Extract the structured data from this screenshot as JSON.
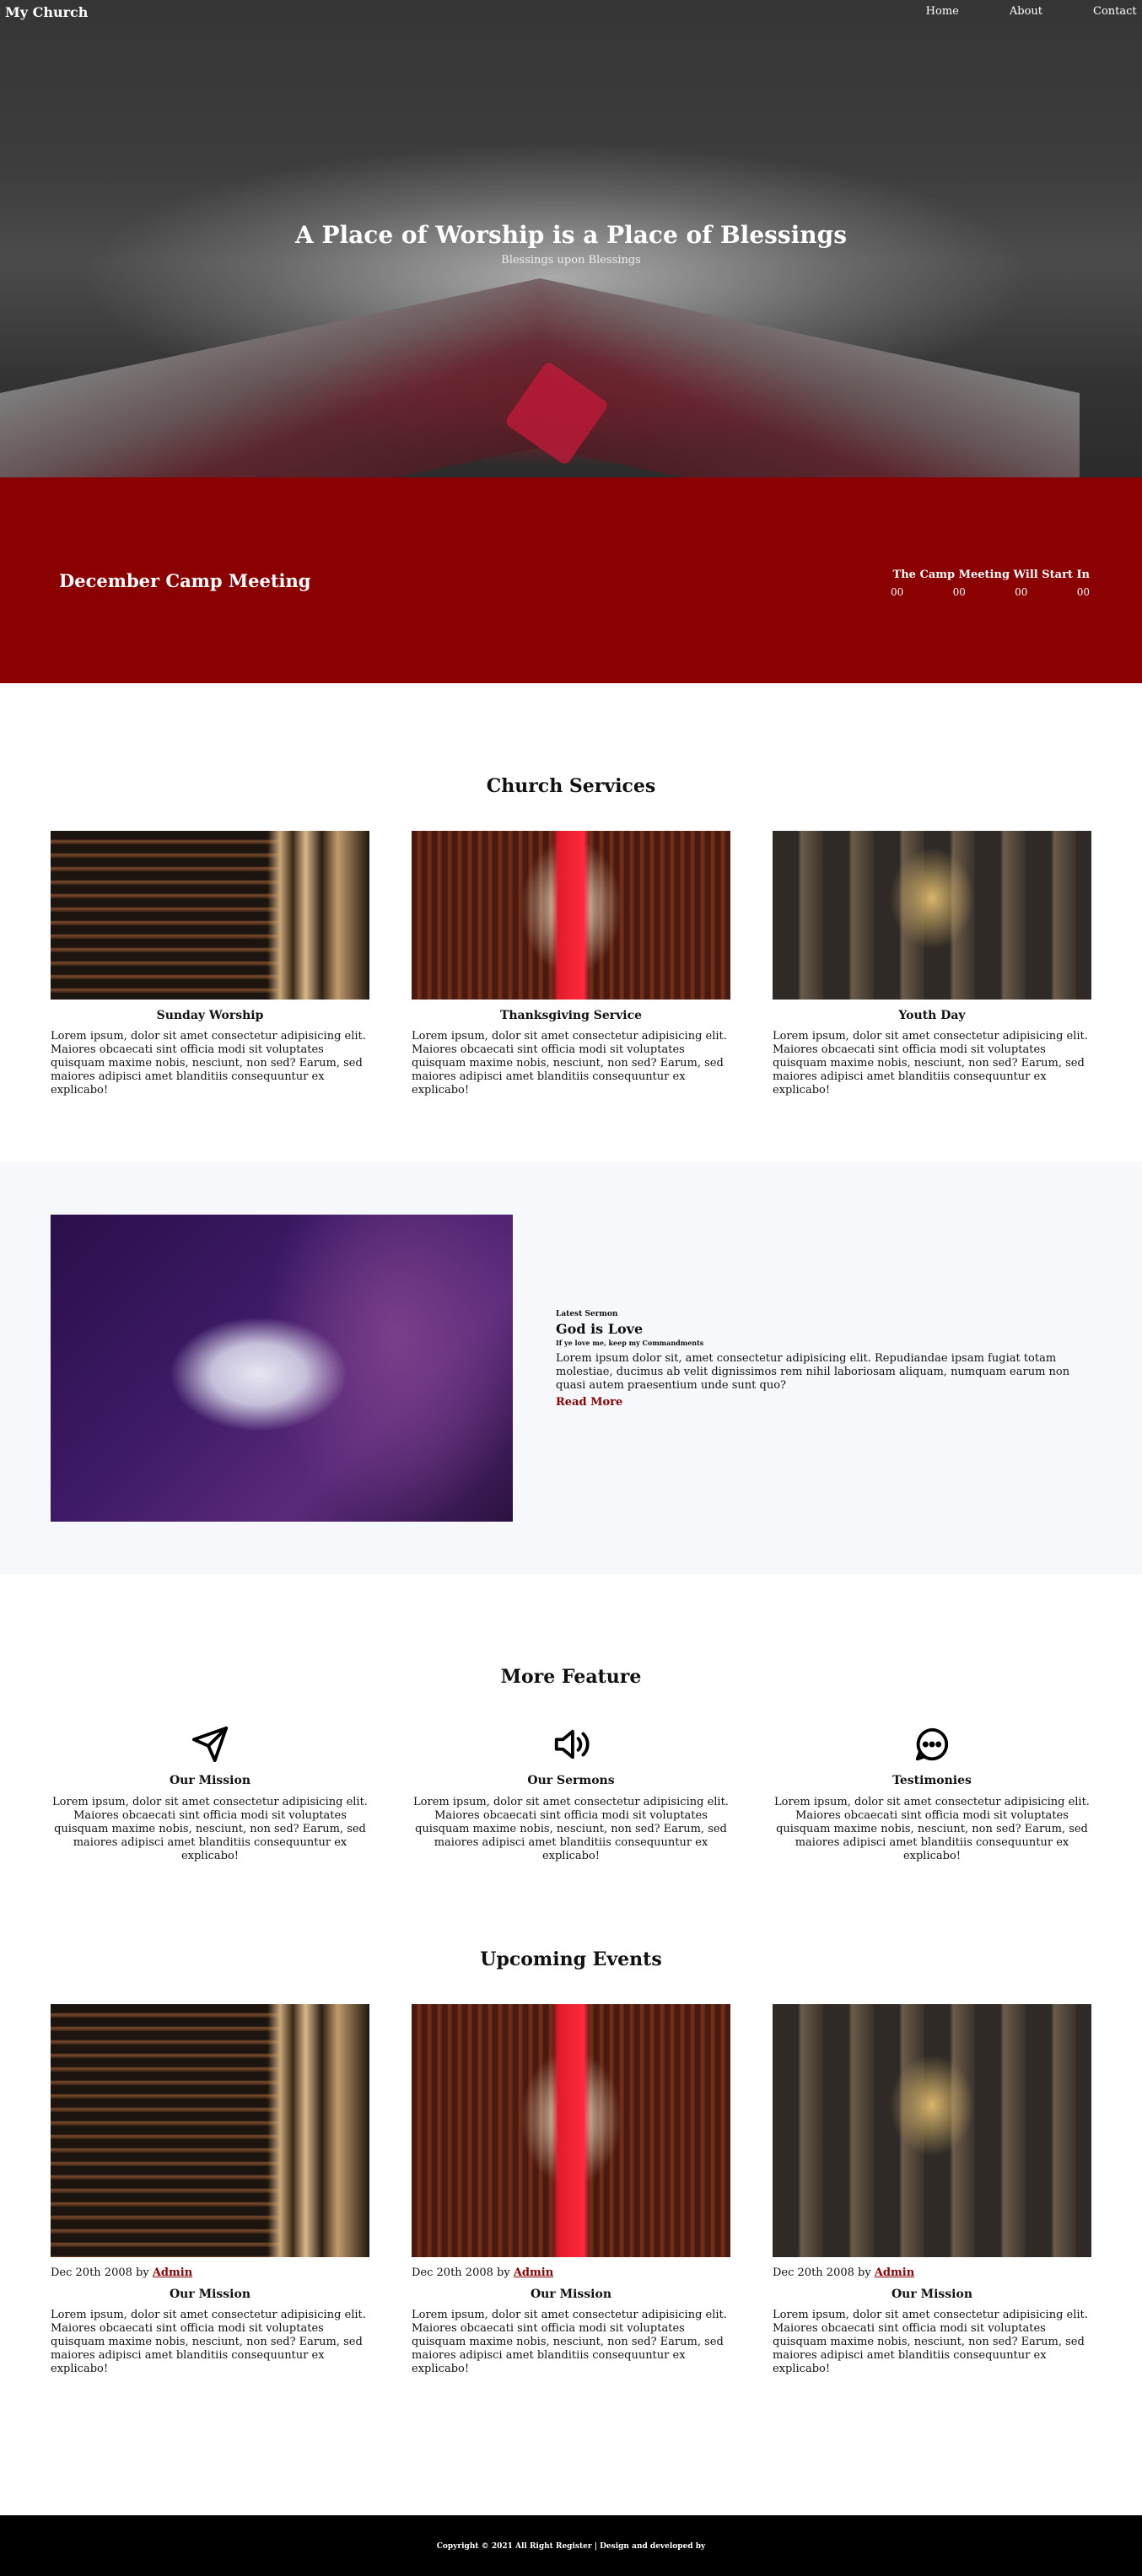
{
  "nav": {
    "brand": "My Church",
    "links": [
      "Home",
      "About",
      "Contact"
    ]
  },
  "hero": {
    "title": "A Place of Worship is a Place of Blessings",
    "subtitle": "Blessings upon Blessings"
  },
  "camp": {
    "title": "December Camp Meeting",
    "countdown_title": "The Camp Meeting Will Start In",
    "countdown": [
      "00",
      "00",
      "00",
      "00"
    ]
  },
  "services": {
    "title": "Church Services",
    "items": [
      {
        "title": "Sunday Worship",
        "text": "Lorem ipsum, dolor sit amet consectetur adipisicing elit. Maiores obcaecati sint officia modi sit voluptates quisquam maxime nobis, nesciunt, non sed? Earum, sed maiores adipisci amet blanditiis consequuntur ex explicabo!"
      },
      {
        "title": "Thanksgiving Service",
        "text": "Lorem ipsum, dolor sit amet consectetur adipisicing elit. Maiores obcaecati sint officia modi sit voluptates quisquam maxime nobis, nesciunt, non sed? Earum, sed maiores adipisci amet blanditiis consequuntur ex explicabo!"
      },
      {
        "title": "Youth Day",
        "text": "Lorem ipsum, dolor sit amet consectetur adipisicing elit. Maiores obcaecati sint officia modi sit voluptates quisquam maxime nobis, nesciunt, non sed? Earum, sed maiores adipisci amet blanditiis consequuntur ex explicabo!"
      }
    ]
  },
  "sermon": {
    "kicker": "Latest Sermon",
    "title": "God is Love",
    "verse": "If ye love me, keep my Commandments",
    "body": "Lorem ipsum dolor sit, amet consectetur adipisicing elit. Repudiandae ipsam fugiat totam molestiae, ducimus ab velit dignissimos rem nihil laboriosam aliquam, numquam earum non quasi autem praesentium unde sunt quo?",
    "read_more": "Read More"
  },
  "features": {
    "title": "More Feature",
    "items": [
      {
        "icon": "send-icon",
        "title": "Our Mission",
        "text": "Lorem ipsum, dolor sit amet consectetur adipisicing elit. Maiores obcaecati sint officia modi sit voluptates quisquam maxime nobis, nesciunt, non sed? Earum, sed maiores adipisci amet blanditiis consequuntur ex explicabo!"
      },
      {
        "icon": "megaphone-icon",
        "title": "Our Sermons",
        "text": "Lorem ipsum, dolor sit amet consectetur adipisicing elit. Maiores obcaecati sint officia modi sit voluptates quisquam maxime nobis, nesciunt, non sed? Earum, sed maiores adipisci amet blanditiis consequuntur ex explicabo!"
      },
      {
        "icon": "chat-bubble-icon",
        "title": "Testimonies",
        "text": "Lorem ipsum, dolor sit amet consectetur adipisicing elit. Maiores obcaecati sint officia modi sit voluptates quisquam maxime nobis, nesciunt, non sed? Earum, sed maiores adipisci amet blanditiis consequuntur ex explicabo!"
      }
    ]
  },
  "events": {
    "title": "Upcoming Events",
    "items": [
      {
        "date": "Dec 20th 2008 by ",
        "author": "Admin",
        "title": "Our Mission",
        "text": "Lorem ipsum, dolor sit amet consectetur adipisicing elit. Maiores obcaecati sint officia modi sit voluptates quisquam maxime nobis, nesciunt, non sed? Earum, sed maiores adipisci amet blanditiis consequuntur ex explicabo!"
      },
      {
        "date": "Dec 20th 2008 by ",
        "author": "Admin",
        "title": "Our Mission",
        "text": "Lorem ipsum, dolor sit amet consectetur adipisicing elit. Maiores obcaecati sint officia modi sit voluptates quisquam maxime nobis, nesciunt, non sed? Earum, sed maiores adipisci amet blanditiis consequuntur ex explicabo!"
      },
      {
        "date": "Dec 20th 2008 by ",
        "author": "Admin",
        "title": "Our Mission",
        "text": "Lorem ipsum, dolor sit amet consectetur adipisicing elit. Maiores obcaecati sint officia modi sit voluptates quisquam maxime nobis, nesciunt, non sed? Earum, sed maiores adipisci amet blanditiis consequuntur ex explicabo!"
      }
    ]
  },
  "footer": {
    "text": "Copyright © 2021 All Right Register | Design and developed by"
  },
  "colors": {
    "accent": "#8b0000",
    "sermon_bg": "#f7f8fc",
    "footer_bg": "#000000"
  }
}
